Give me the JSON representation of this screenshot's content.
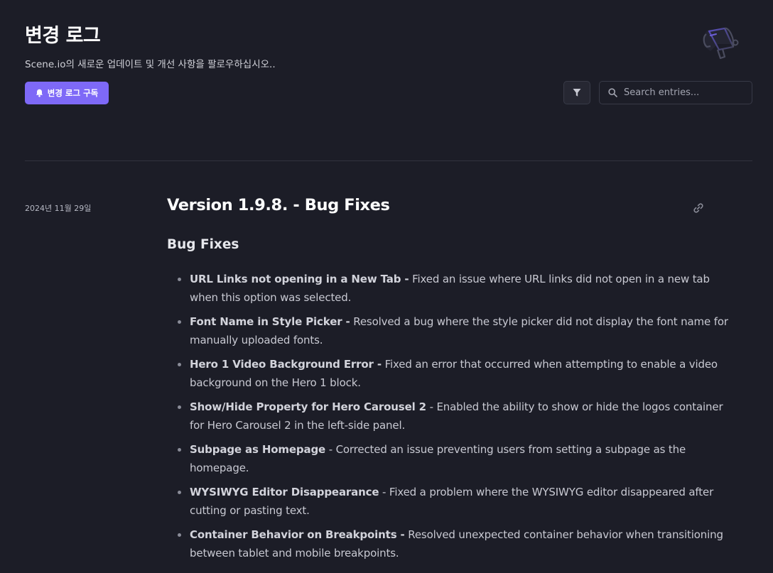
{
  "header": {
    "title": "변경 로그",
    "subtitle": "Scene.io의 새로운 업데이트 및 개선 사항을 팔로우하십시오..",
    "subscribe_label": "변경 로그 구독",
    "megaphone_icon": "megaphone-icon"
  },
  "toolbar": {
    "filter_icon": "filter-icon",
    "search_placeholder": "Search entries..."
  },
  "entry": {
    "date": "2024년 11월 29일",
    "title": "Version 1.9.8. - Bug Fixes",
    "section_heading": "Bug Fixes",
    "items": [
      {
        "name": "URL Links not opening in a New Tab -",
        "description": " Fixed an issue where URL links did not open in a new tab when this option was selected."
      },
      {
        "name": "Font Name in Style Picker -",
        "description": " Resolved a bug where the style picker did not display the font name for manually uploaded fonts."
      },
      {
        "name": "Hero 1 Video Background Error -",
        "description": " Fixed an error that occurred when attempting to enable a video background on the Hero 1 block."
      },
      {
        "name": "Show/Hide Property for Hero Carousel 2",
        "description": " - Enabled the ability to show or hide the logos container for Hero Carousel 2 in the left-side panel."
      },
      {
        "name": "Subpage as Homepage",
        "description": " - Corrected an issue preventing users from setting a subpage as the homepage."
      },
      {
        "name": "WYSIWYG Editor Disappearance",
        "description": " - Fixed a problem where the WYSIWYG editor disappeared after cutting or pasting text."
      },
      {
        "name": "Container Behavior on Breakpoints -",
        "description": " Resolved unexpected container behavior when transitioning between tablet and mobile breakpoints."
      }
    ]
  },
  "colors": {
    "background": "#1c1d27",
    "accent": "#7e69f7",
    "border": "#383a47"
  }
}
